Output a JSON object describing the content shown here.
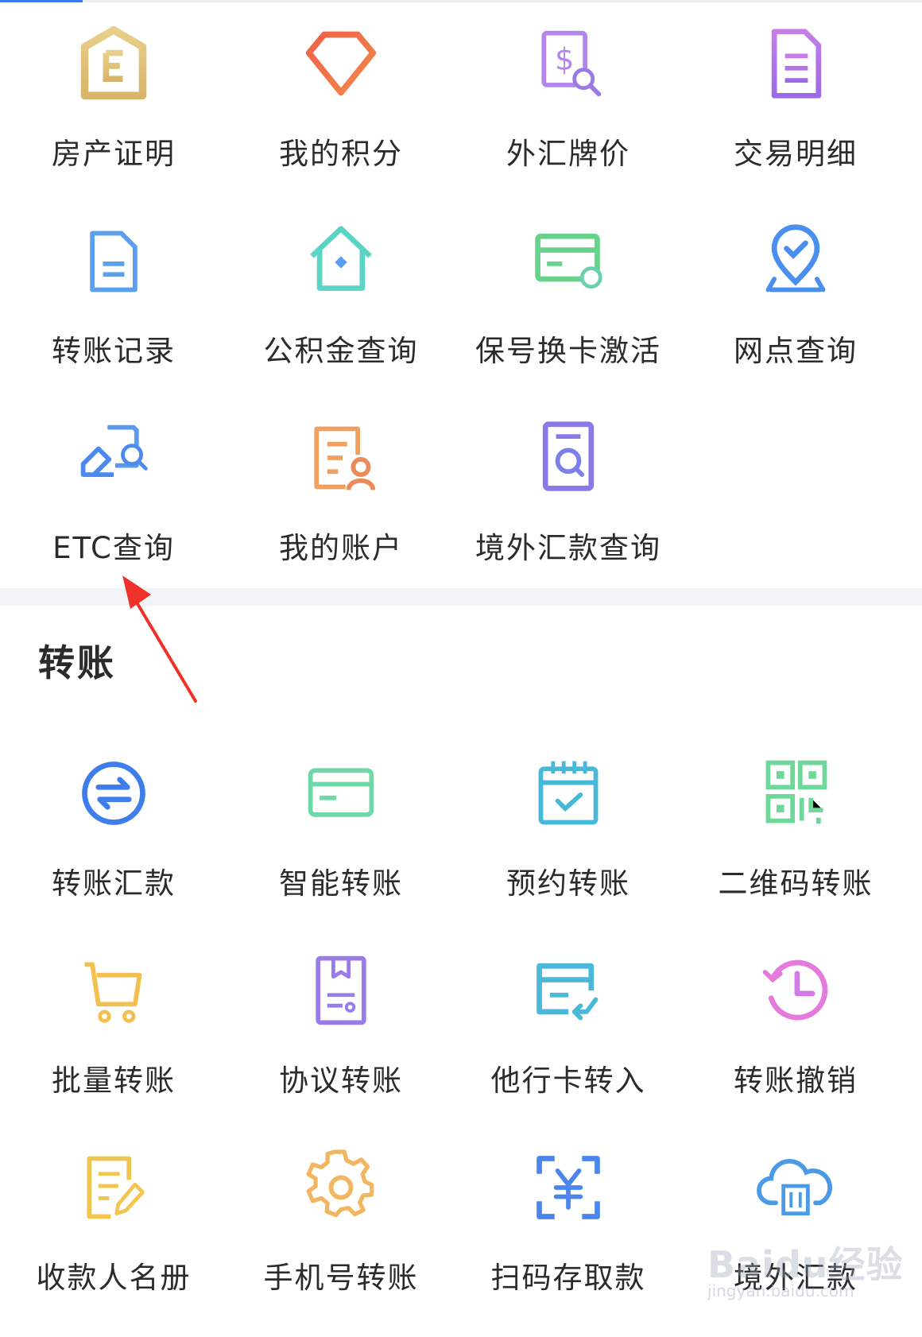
{
  "services_section": {
    "items": [
      {
        "label": "房产证明",
        "icon": "house-certificate-icon"
      },
      {
        "label": "我的积分",
        "icon": "diamond-points-icon"
      },
      {
        "label": "外汇牌价",
        "icon": "exchange-rate-icon"
      },
      {
        "label": "交易明细",
        "icon": "document-list-icon"
      },
      {
        "label": "转账记录",
        "icon": "record-document-icon"
      },
      {
        "label": "公积金查询",
        "icon": "house-fund-icon"
      },
      {
        "label": "保号换卡激活",
        "icon": "card-refresh-icon"
      },
      {
        "label": "网点查询",
        "icon": "location-check-icon"
      },
      {
        "label": "ETC查询",
        "icon": "etc-search-icon"
      },
      {
        "label": "我的账户",
        "icon": "account-user-icon"
      },
      {
        "label": "境外汇款查询",
        "icon": "remittance-search-icon"
      }
    ]
  },
  "transfer_section": {
    "title": "转账",
    "items": [
      {
        "label": "转账汇款",
        "icon": "swap-circle-icon"
      },
      {
        "label": "智能转账",
        "icon": "card-icon"
      },
      {
        "label": "预约转账",
        "icon": "calendar-check-icon"
      },
      {
        "label": "二维码转账",
        "icon": "qr-code-icon"
      },
      {
        "label": "批量转账",
        "icon": "cart-icon"
      },
      {
        "label": "协议转账",
        "icon": "agreement-document-icon"
      },
      {
        "label": "他行卡转入",
        "icon": "card-transfer-in-icon"
      },
      {
        "label": "转账撤销",
        "icon": "history-clock-icon"
      },
      {
        "label": "收款人名册",
        "icon": "edit-document-icon"
      },
      {
        "label": "手机号转账",
        "icon": "gear-icon"
      },
      {
        "label": "扫码存取款",
        "icon": "scan-yuan-icon"
      },
      {
        "label": "境外汇款",
        "icon": "cloud-transfer-icon"
      }
    ]
  },
  "watermark": {
    "brand": "Baidu经验",
    "url": "jingyan.baidu.com"
  },
  "colors": {
    "gold": "#dcc07a",
    "red": "#f06448",
    "purple": "#a77ee8",
    "blue": "#4f8fee",
    "teal": "#5fd6c8",
    "green": "#6fd6a0",
    "annotation_arrow": "#f0302a"
  }
}
